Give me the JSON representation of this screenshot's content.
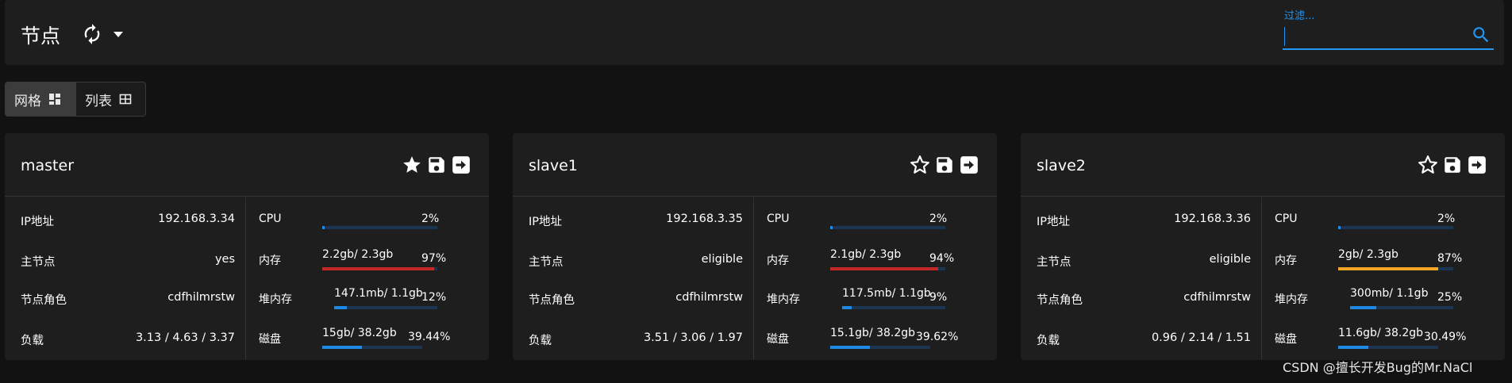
{
  "header": {
    "title": "节点",
    "refresh_icon": "refresh-icon",
    "dropdown_icon": "caret-down-icon",
    "filter_label": "过滤...",
    "filter_value": "",
    "search_icon": "search-icon"
  },
  "view_toggle": {
    "grid_label": "网格",
    "grid_icon": "grid-view-icon",
    "list_label": "列表",
    "list_icon": "table-view-icon",
    "active": "grid"
  },
  "labels": {
    "ip": "IP地址",
    "master": "主节点",
    "roles": "节点角色",
    "load": "负载",
    "cpu": "CPU",
    "memory": "内存",
    "heap": "堆内存",
    "disk": "磁盘"
  },
  "nodes": [
    {
      "name": "master",
      "favorite": true,
      "ip": "192.168.3.34",
      "master": "yes",
      "roles": "cdfhilmrstw",
      "load": "3.13 / 4.63 / 3.37",
      "cpu": {
        "detail": "",
        "pct": "2%",
        "fraction": 0.02,
        "color": "#1e88e5"
      },
      "memory": {
        "detail": "2.2gb/ 2.3gb",
        "pct": "97%",
        "fraction": 0.97,
        "color": "#c62828"
      },
      "heap": {
        "detail": "147.1mb/ 1.1gb",
        "pct": "12%",
        "fraction": 0.12,
        "color": "#1e88e5"
      },
      "disk": {
        "detail": "15gb/ 38.2gb",
        "pct": "39.44%",
        "fraction": 0.3944,
        "color": "#1e88e5"
      }
    },
    {
      "name": "slave1",
      "favorite": false,
      "ip": "192.168.3.35",
      "master": "eligible",
      "roles": "cdfhilmrstw",
      "load": "3.51 / 3.06 / 1.97",
      "cpu": {
        "detail": "",
        "pct": "2%",
        "fraction": 0.02,
        "color": "#1e88e5"
      },
      "memory": {
        "detail": "2.1gb/ 2.3gb",
        "pct": "94%",
        "fraction": 0.94,
        "color": "#c62828"
      },
      "heap": {
        "detail": "117.5mb/ 1.1gb",
        "pct": "9%",
        "fraction": 0.09,
        "color": "#1e88e5"
      },
      "disk": {
        "detail": "15.1gb/ 38.2gb",
        "pct": "39.62%",
        "fraction": 0.3962,
        "color": "#1e88e5"
      }
    },
    {
      "name": "slave2",
      "favorite": false,
      "ip": "192.168.3.36",
      "master": "eligible",
      "roles": "cdfhilmrstw",
      "load": "0.96 / 2.14 / 1.51",
      "cpu": {
        "detail": "",
        "pct": "2%",
        "fraction": 0.02,
        "color": "#1e88e5"
      },
      "memory": {
        "detail": "2gb/ 2.3gb",
        "pct": "87%",
        "fraction": 0.87,
        "color": "#f5a623"
      },
      "heap": {
        "detail": "300mb/ 1.1gb",
        "pct": "25%",
        "fraction": 0.25,
        "color": "#1e88e5"
      },
      "disk": {
        "detail": "11.6gb/ 38.2gb",
        "pct": "30.49%",
        "fraction": 0.3049,
        "color": "#1e88e5"
      }
    }
  ],
  "watermark": "CSDN @擅长开发Bug的Mr.NaCl"
}
